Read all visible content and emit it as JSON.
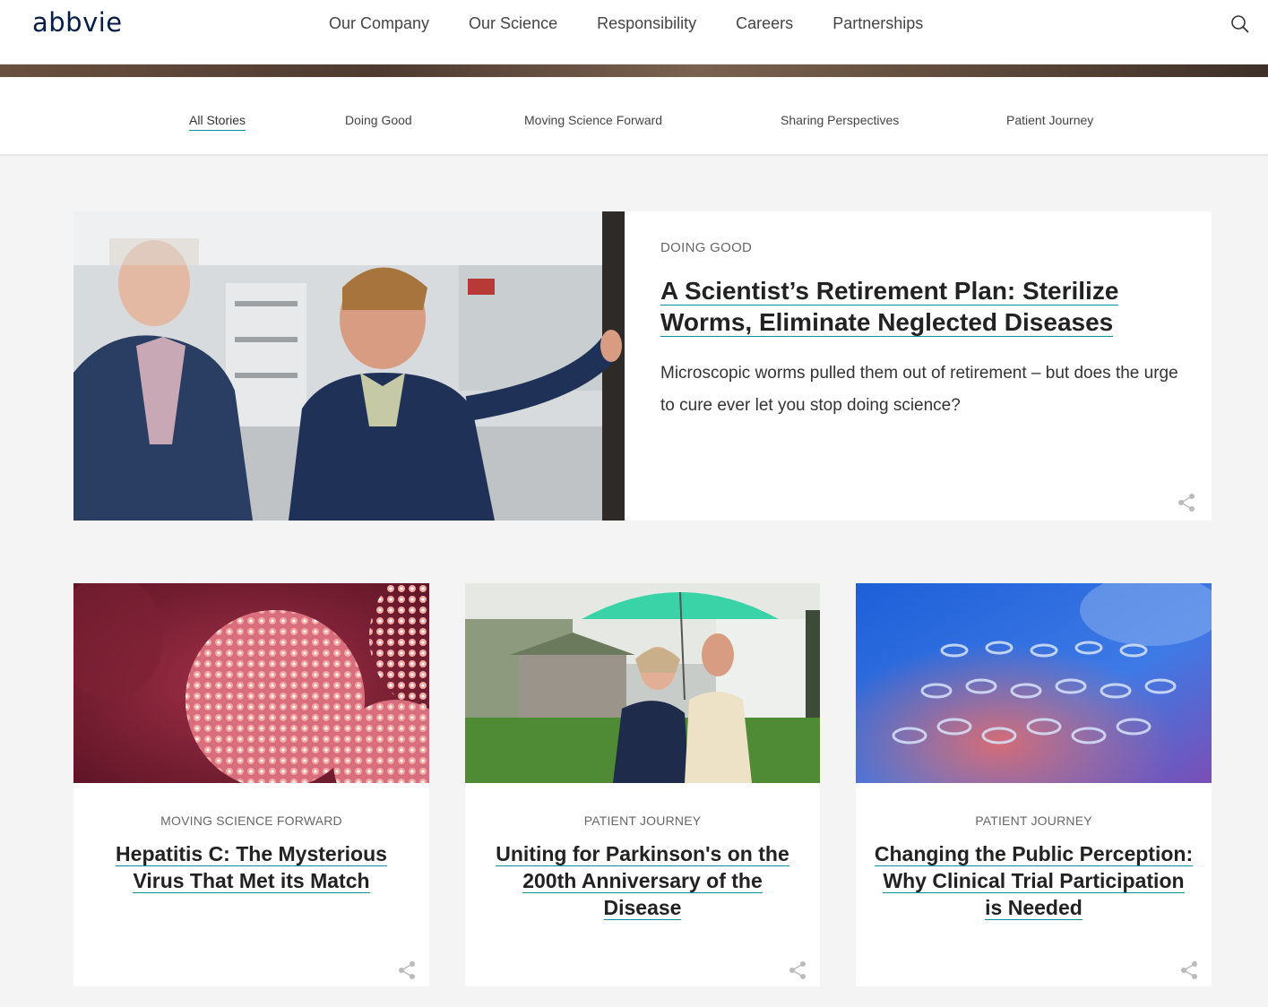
{
  "header": {
    "logo": "abbvie",
    "nav": [
      "Our Company",
      "Our Science",
      "Responsibility",
      "Careers",
      "Partnerships"
    ]
  },
  "subnav": {
    "items": [
      "All Stories",
      "Doing Good",
      "Moving Science Forward",
      "Sharing Perspectives",
      "Patient Journey"
    ],
    "active": "All Stories"
  },
  "featured": {
    "category": "DOING GOOD",
    "title_line1": "A Scientist’s Retirement Plan: Sterilize",
    "title_line2": "Worms, Eliminate Neglected Diseases",
    "description": "Microscopic worms pulled them out of retirement – but does the urge to cure ever let you stop doing science?"
  },
  "cards": [
    {
      "category": "MOVING SCIENCE FORWARD",
      "title_lines": [
        "Hepatitis C: The Mysterious",
        "Virus That Met its Match"
      ]
    },
    {
      "category": "PATIENT JOURNEY",
      "title_lines": [
        "Uniting for Parkinson's on the",
        "200th Anniversary of the",
        "Disease"
      ]
    },
    {
      "category": "PATIENT JOURNEY",
      "title_lines": [
        "Changing the Public Perception:",
        "Why Clinical Trial Participation",
        "is Needed"
      ]
    }
  ],
  "colors": {
    "brand": "#071d49",
    "accent": "#0a8f9e"
  },
  "icons": {
    "search": "search-icon",
    "share": "share-icon"
  }
}
